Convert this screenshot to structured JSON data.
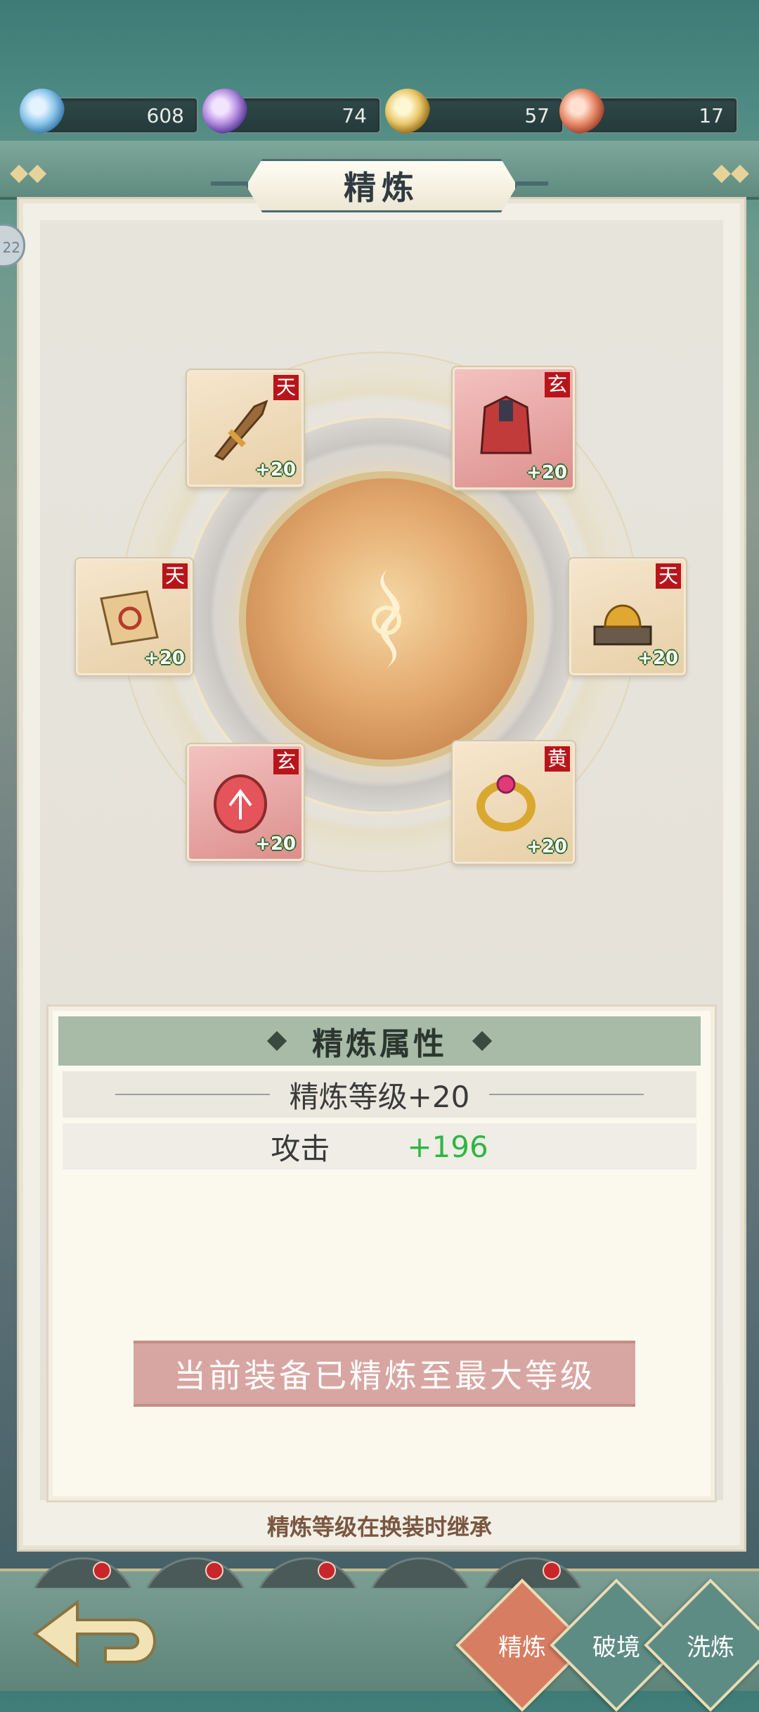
{
  "resources": [
    {
      "icon": "blue-essence-icon",
      "value": "608"
    },
    {
      "icon": "purple-essence-icon",
      "value": "74"
    },
    {
      "icon": "gold-essence-icon",
      "value": "57"
    },
    {
      "icon": "red-essence-icon",
      "value": "17"
    }
  ],
  "title": "精炼",
  "side_badge": "22",
  "equipment": [
    {
      "name": "sword",
      "grade": "天",
      "level": "+20",
      "bg": "tan"
    },
    {
      "name": "armor",
      "grade": "玄",
      "level": "+20",
      "bg": "red"
    },
    {
      "name": "talisman",
      "grade": "天",
      "level": "+20",
      "bg": "tan"
    },
    {
      "name": "beast-seal",
      "grade": "天",
      "level": "+20",
      "bg": "tan"
    },
    {
      "name": "jade-pendant",
      "grade": "玄",
      "level": "+20",
      "bg": "red"
    },
    {
      "name": "ring",
      "grade": "黄",
      "level": "+20",
      "bg": "tan"
    }
  ],
  "attributes": {
    "heading": "精炼属性",
    "level_text": "精炼等级+20",
    "stat_name": "攻击",
    "stat_value": "+196"
  },
  "max_notice": "当前装备已精炼至最大等级",
  "inherit_note": "精炼等级在换装时继承",
  "tabs": [
    {
      "label": "精炼",
      "active": true
    },
    {
      "label": "破境",
      "active": false
    },
    {
      "label": "洗炼",
      "active": false
    }
  ],
  "colors": {
    "accent_green": "#2fb544",
    "grade_red": "#b8151b",
    "active_tab": "#d77d62",
    "tab": "#5d8c84"
  }
}
